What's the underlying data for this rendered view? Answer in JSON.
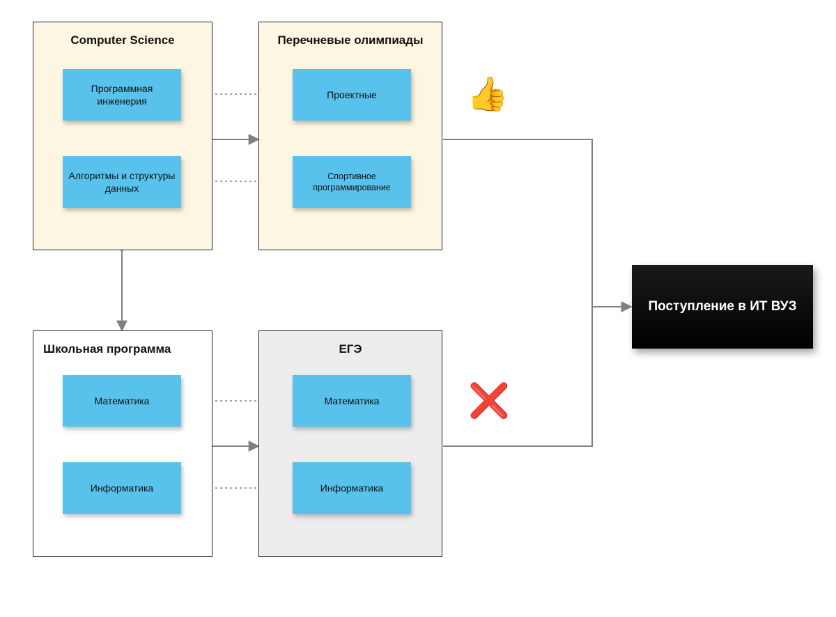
{
  "groups": {
    "cs": {
      "title": "Computer Science"
    },
    "olymp": {
      "title": "Перечневые олимпиады"
    },
    "school": {
      "title": "Школьная программа"
    },
    "ege": {
      "title": "ЕГЭ"
    }
  },
  "notes": {
    "sw_eng": "Программная инженерия",
    "algos": "Алгоритмы и структуры данных",
    "project": "Проектные",
    "sport_prog": "Спортивное программирование",
    "math_school": "Математика",
    "cs_school": "Информатика",
    "math_ege": "Математика",
    "cs_ege": "Информатика"
  },
  "result": "Поступление в ИТ ВУЗ",
  "icons": {
    "thumbs_up": "👍",
    "cross": "❌"
  },
  "colors": {
    "cream_bg": "#FDF6E3",
    "gray_bg": "#EDEDED",
    "sticky": "#58C2EC",
    "arrow": "#808080"
  }
}
